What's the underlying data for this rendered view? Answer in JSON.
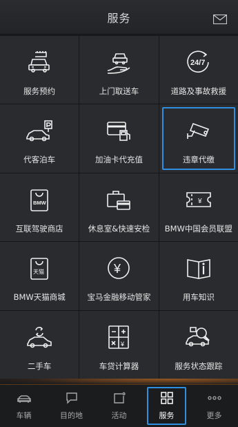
{
  "header": {
    "title": "服务",
    "mail_icon": "mail-icon"
  },
  "grid": {
    "items": [
      {
        "label": "服务预约",
        "icon": "service-booking-icon"
      },
      {
        "label": "上门取送车",
        "icon": "car-pickup-icon"
      },
      {
        "label": "道路及事故救援",
        "icon": "roadside-24-7-icon"
      },
      {
        "label": "代客泊车",
        "icon": "valet-parking-icon"
      },
      {
        "label": "加油卡代充值",
        "icon": "fuel-card-icon"
      },
      {
        "label": "违章代缴",
        "icon": "traffic-camera-icon",
        "selected": true
      },
      {
        "label": "互联驾驶商店",
        "icon": "bmw-shop-bag-icon",
        "icon_text": "BMW"
      },
      {
        "label": "休息室&快速安检",
        "icon": "lounge-briefcase-icon"
      },
      {
        "label": "BMW中国会员联盟",
        "icon": "member-card-icon",
        "icon_text": "¥"
      },
      {
        "label": "BMW天猫商城",
        "icon": "tmall-bag-icon",
        "icon_text": "天猫"
      },
      {
        "label": "宝马金融移动管家",
        "icon": "yuan-coin-icon",
        "icon_text": "¥"
      },
      {
        "label": "用车知识",
        "icon": "book-info-icon"
      },
      {
        "label": "二手车",
        "icon": "used-car-icon"
      },
      {
        "label": "车贷计算器",
        "icon": "calculator-icon"
      },
      {
        "label": "服务状态跟踪",
        "icon": "service-tracking-icon"
      }
    ]
  },
  "tabbar": {
    "tabs": [
      {
        "label": "车辆",
        "icon": "car-icon"
      },
      {
        "label": "目的地",
        "icon": "destination-icon"
      },
      {
        "label": "活动",
        "icon": "activity-icon"
      },
      {
        "label": "服务",
        "icon": "grid-icon",
        "active": true
      },
      {
        "label": "更多",
        "icon": "more-dots-icon"
      }
    ]
  },
  "colors": {
    "background": "#2a2b2e",
    "selection": "#2f8fe0",
    "accent_glow": "#ff8c28"
  }
}
